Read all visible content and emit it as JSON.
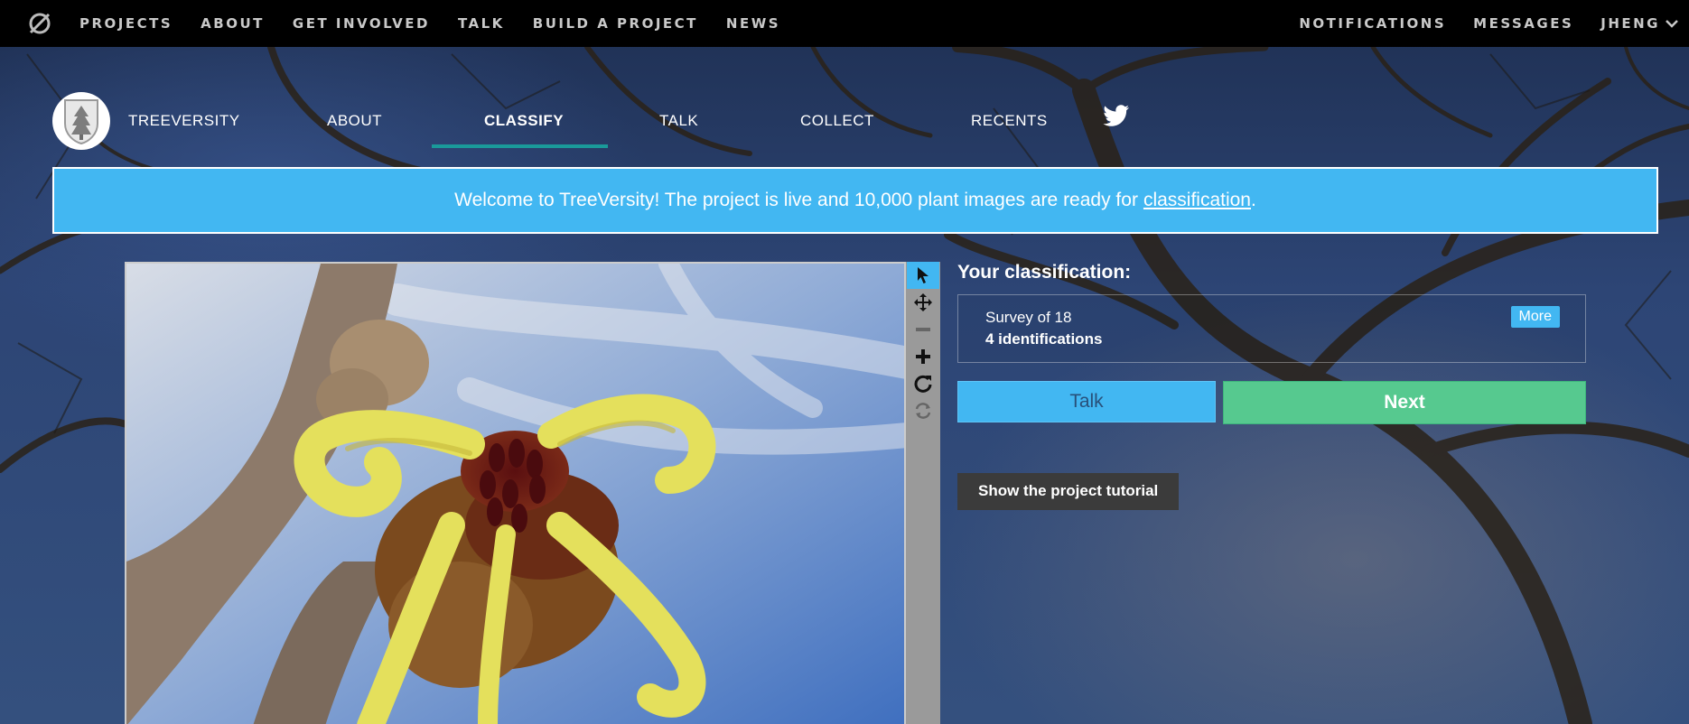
{
  "topnav": {
    "logo_icon": "zooniverse-logo-icon",
    "links": [
      "PROJECTS",
      "ABOUT",
      "GET INVOLVED",
      "TALK",
      "BUILD A PROJECT",
      "NEWS"
    ],
    "right": {
      "notifications": "NOTIFICATIONS",
      "messages": "MESSAGES",
      "user": "JHENG",
      "user_icon": "chevron-down-icon"
    }
  },
  "project_nav": {
    "avatar_icon": "tree-avatar-icon",
    "items": [
      {
        "label": "TREEVERSITY",
        "active": false
      },
      {
        "label": "ABOUT",
        "active": false
      },
      {
        "label": "CLASSIFY",
        "active": true
      },
      {
        "label": "TALK",
        "active": false
      },
      {
        "label": "COLLECT",
        "active": false
      },
      {
        "label": "RECENTS",
        "active": false
      }
    ],
    "social_icon": "twitter-icon"
  },
  "banner": {
    "text": "Welcome to TreeVersity! The project is live and 10,000 plant images are ready for",
    "link": "classification",
    "suffix": "."
  },
  "toolbar": {
    "tools": [
      {
        "icon": "pointer-icon",
        "active": true
      },
      {
        "icon": "move-icon",
        "active": false
      },
      {
        "icon": "zoom-out-icon",
        "active": false
      },
      {
        "icon": "zoom-in-icon",
        "active": false
      },
      {
        "icon": "rotate-icon",
        "active": false
      },
      {
        "icon": "reset-icon",
        "active": false
      }
    ]
  },
  "classification": {
    "title": "Your classification:",
    "task": "Survey of 18",
    "count": "4 identifications",
    "more_label": "More",
    "talk_label": "Talk",
    "next_label": "Next",
    "tutorial_label": "Show the project tutorial"
  },
  "colors": {
    "accent": "#42b7f2",
    "next": "#56c98f",
    "active_tab": "#1a9a9a",
    "topbar": "#000000"
  }
}
